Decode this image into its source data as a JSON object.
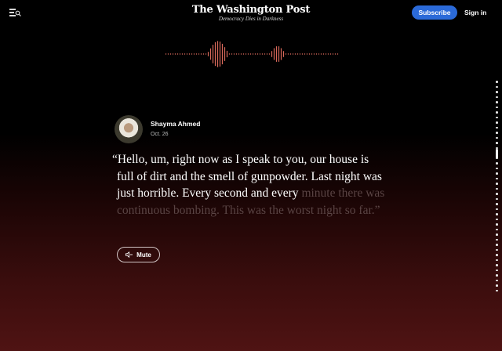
{
  "header": {
    "logo": "The Washington Post",
    "tagline": "Democracy Dies in Darkness",
    "subscribe_label": "Subscribe",
    "signin_label": "Sign in"
  },
  "author": {
    "name": "Shayma Ahmed",
    "date": "Oct. 26"
  },
  "quote": {
    "spoken": "“Hello, um, right now as I speak to you, our house is full of dirt and the smell of gunpowder. Last night was just horrible. Every second and every",
    "upcoming": " minute there was continuous bombing. This was the worst night so far.”"
  },
  "controls": {
    "mute_label": "Mute"
  },
  "icons": {
    "menu": "menu-search-icon",
    "volume": "speaker-icon"
  },
  "colors": {
    "accent": "#2b6ad8",
    "waveform": "#d96a5b",
    "text_dim": "#5a4444"
  }
}
